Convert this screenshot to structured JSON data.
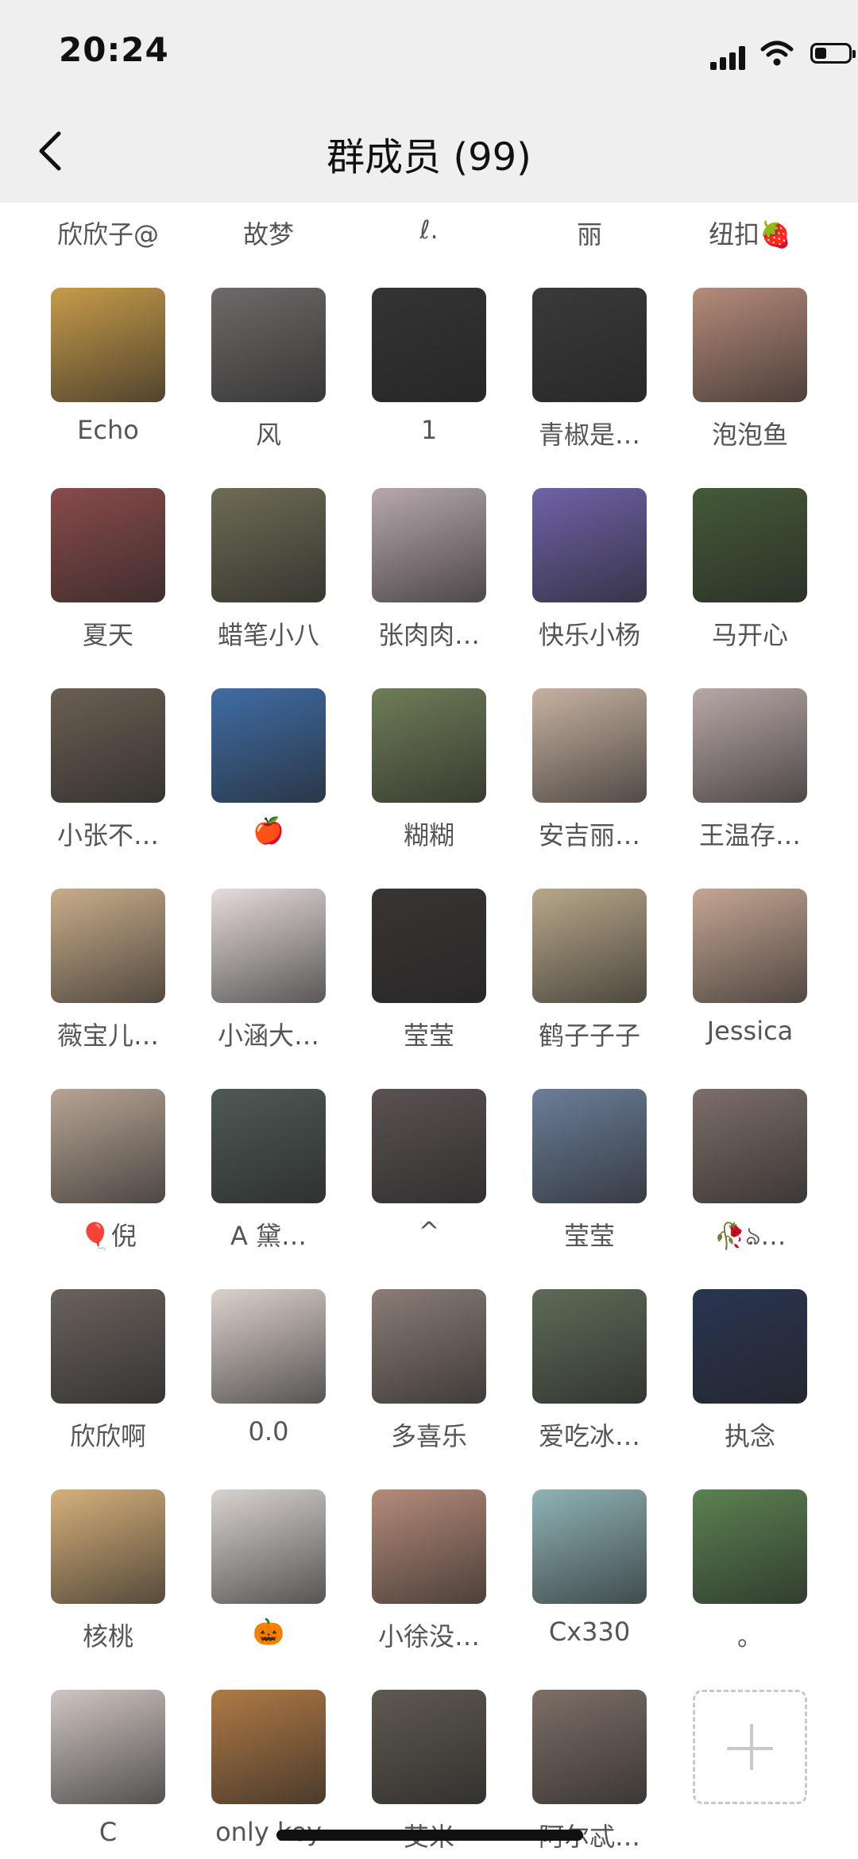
{
  "status_bar": {
    "time": "20:24"
  },
  "header": {
    "title": "群成员 (99)"
  },
  "top_row": [
    "欣欣子@",
    "故梦",
    "ℓ.",
    "丽",
    "纽扣🍓"
  ],
  "members": [
    {
      "name": "Echo",
      "color": "#c79b4a"
    },
    {
      "name": "风",
      "color": "#6f6a6a"
    },
    {
      "name": "1",
      "color": "#343434"
    },
    {
      "name": "青椒是…",
      "color": "#3b3a3a"
    },
    {
      "name": "泡泡鱼",
      "color": "#b68b7a"
    },
    {
      "name": "夏天",
      "color": "#8a4b4b"
    },
    {
      "name": "蜡笔小八",
      "color": "#6e6b55"
    },
    {
      "name": "张肉肉…",
      "color": "#b7a8ad"
    },
    {
      "name": "快乐小杨",
      "color": "#6f62a8"
    },
    {
      "name": "马开心",
      "color": "#455a38"
    },
    {
      "name": "小张不…",
      "color": "#6b5f52"
    },
    {
      "name": "🍎",
      "color": "#3f6da5"
    },
    {
      "name": "糊糊",
      "color": "#6f7d57"
    },
    {
      "name": "安吉丽…",
      "color": "#c7b2a1"
    },
    {
      "name": "王温存…",
      "color": "#b9a8a7"
    },
    {
      "name": "薇宝儿…",
      "color": "#c9ad8a"
    },
    {
      "name": "小涵大…",
      "color": "#e6dcdc"
    },
    {
      "name": "莹莹",
      "color": "#3a3535"
    },
    {
      "name": "鹤子子子",
      "color": "#b8a889"
    },
    {
      "name": "Jessica",
      "color": "#c5a693"
    },
    {
      "name": "🎈倪",
      "color": "#b7a595"
    },
    {
      "name": "A 黛…",
      "color": "#4e5a55"
    },
    {
      "name": "^",
      "color": "#5b5252"
    },
    {
      "name": "莹莹",
      "color": "#6b7e99"
    },
    {
      "name": "🥀ঌ…",
      "color": "#7d6e68"
    },
    {
      "name": "欣欣啊",
      "color": "#6a625d"
    },
    {
      "name": "0.0",
      "color": "#dcd2cc"
    },
    {
      "name": "多喜乐",
      "color": "#8a7d75"
    },
    {
      "name": "爱吃冰…",
      "color": "#5e6b57"
    },
    {
      "name": "执念",
      "color": "#2a3552"
    },
    {
      "name": "核桃",
      "color": "#d6b07a"
    },
    {
      "name": "🎃",
      "color": "#d9d3cf"
    },
    {
      "name": "小徐没…",
      "color": "#b58b79"
    },
    {
      "name": "Cx330",
      "color": "#8fb3b6"
    },
    {
      "name": "。",
      "color": "#5b8251"
    },
    {
      "name": "C",
      "color": "#cfc6c2"
    },
    {
      "name": "only key",
      "color": "#b07a45"
    },
    {
      "name": "艾米",
      "color": "#5f5a50"
    },
    {
      "name": "阿尔忒…",
      "color": "#7d6f66"
    }
  ],
  "add_label": "+"
}
